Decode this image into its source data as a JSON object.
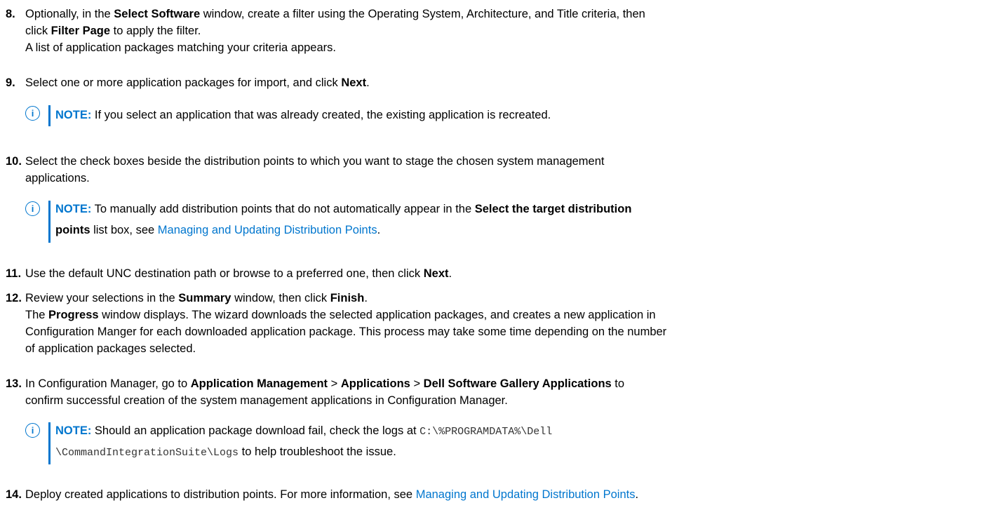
{
  "steps": {
    "s8": {
      "num": "8.",
      "l1a": "Optionally, in the ",
      "l1b": "Select Software",
      "l1c": " window, create a filter using the Operating System, Architecture, and Title criteria, then",
      "l2a": "click ",
      "l2b": "Filter Page",
      "l2c": " to apply the filter.",
      "l3": "A list of application packages matching your criteria appears."
    },
    "s9": {
      "num": "9.",
      "a": "Select one or more application packages for import, and click ",
      "b": "Next",
      "c": ".",
      "note_label": "NOTE:",
      "note_text": " If you select an application that was already created, the existing application is recreated."
    },
    "s10": {
      "num": "10.",
      "l1": "Select the check boxes beside the distribution points to which you want to stage the chosen system management",
      "l2": "applications.",
      "note_label": "NOTE:",
      "note_a": " To manually add distribution points that do not automatically appear in the ",
      "note_b": "Select the target distribution",
      "note_c": "points",
      "note_d": " list box, see ",
      "note_link": "Managing and Updating Distribution Points",
      "note_e": "."
    },
    "s11": {
      "num": "11.",
      "a": "Use the default UNC destination path or browse to a preferred one, then click ",
      "b": "Next",
      "c": "."
    },
    "s12": {
      "num": "12.",
      "a": "Review your selections in the ",
      "b": "Summary",
      "c": " window, then click ",
      "d": "Finish",
      "e": ".",
      "l2a": "The ",
      "l2b": "Progress",
      "l2c": " window displays. The wizard downloads the selected application packages, and creates a new application in",
      "l3": "Configuration Manger for each downloaded application package. This process may take some time depending on the number",
      "l4": "of application packages selected."
    },
    "s13": {
      "num": "13.",
      "a": "In Configuration Manager, go to ",
      "b": "Application Management",
      "c": " > ",
      "d": "Applications",
      "e": " > ",
      "f": "Dell Software Gallery Applications",
      "g": " to",
      "l2": "confirm successful creation of the system management applications in Configuration Manager.",
      "note_label": "NOTE:",
      "note_a": " Should an application package download fail, check the logs at ",
      "note_code1": "C:\\%PROGRAMDATA%\\Dell",
      "note_code2": "\\CommandIntegrationSuite\\Logs",
      "note_b": " to help troubleshoot the issue."
    },
    "s14": {
      "num": "14.",
      "a": "Deploy created applications to distribution points. For more information, see ",
      "link": "Managing and Updating Distribution Points",
      "b": "."
    }
  },
  "note_icon": "info-icon",
  "accent_color": "#0076ce"
}
